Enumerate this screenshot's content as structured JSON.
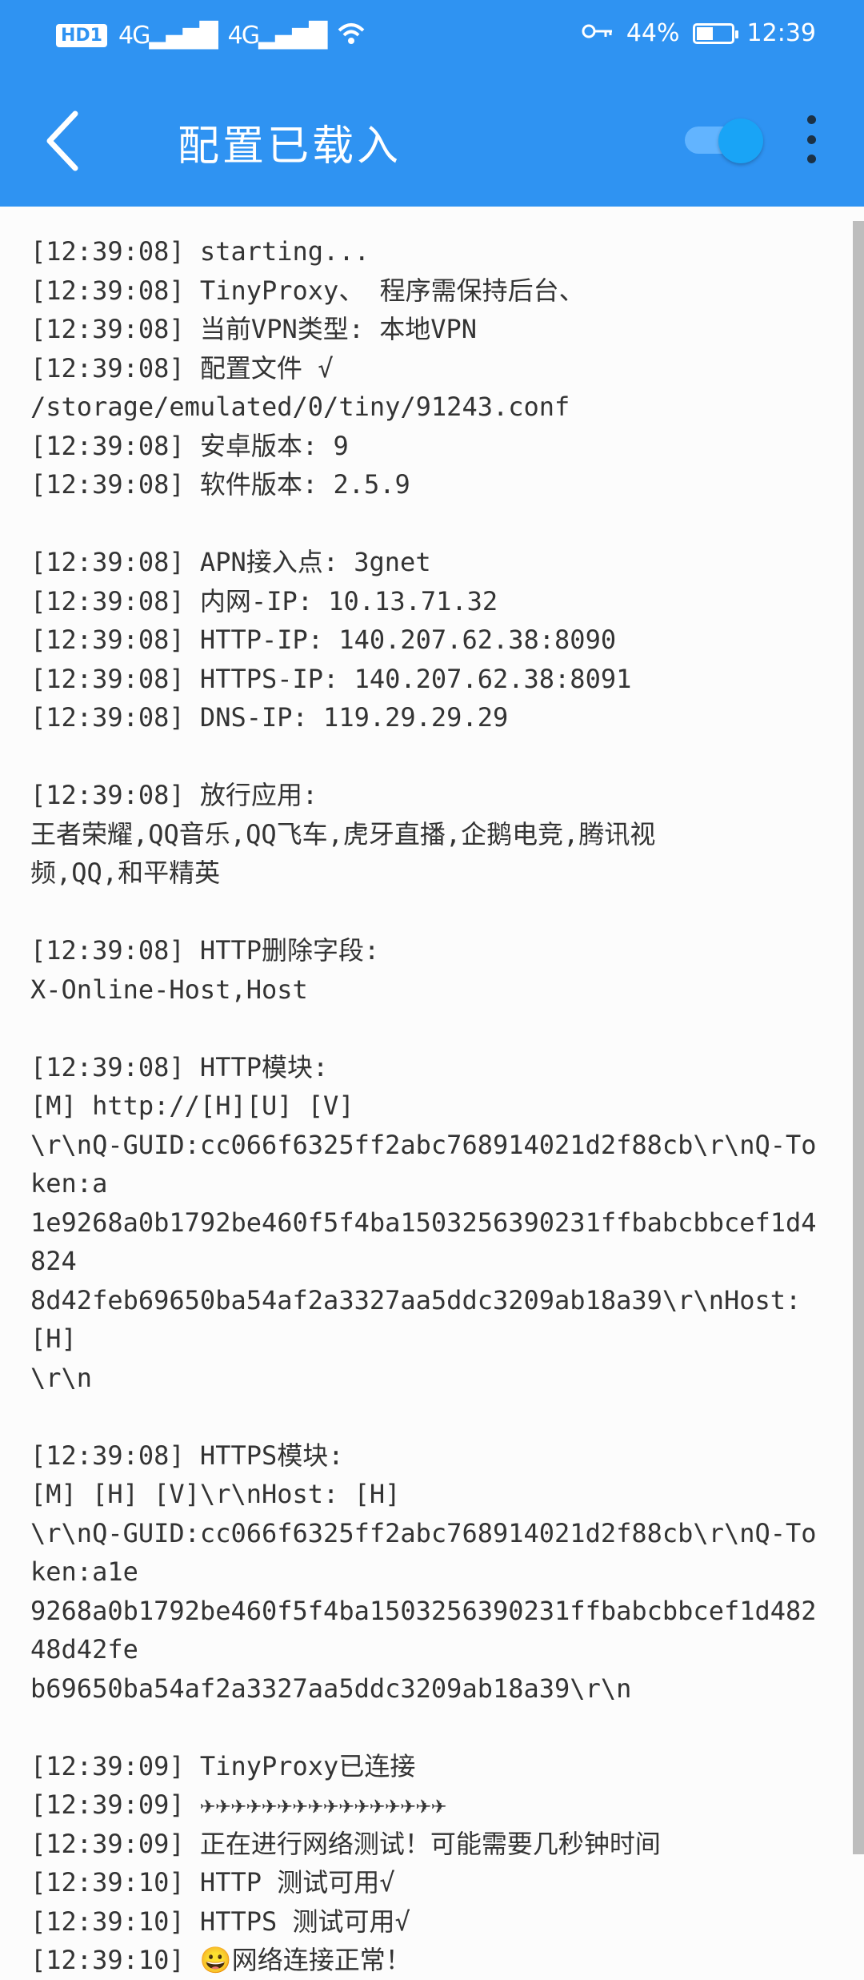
{
  "status_bar": {
    "left_items": [
      "HD1",
      "4G",
      "4G",
      "wifi-icon"
    ],
    "right_text": "44%",
    "time": "12:39",
    "battery_level": 0.44
  },
  "app_bar": {
    "title": "配置已载入",
    "toggle_on": true,
    "icons": [
      "back-arrow-icon",
      "toggle-switch",
      "more-vert-icon"
    ]
  },
  "log_lines": [
    "[12:39:08] starting...",
    "[12:39:08] TinyProxy、 程序需保持后台、",
    "[12:39:08] 当前VPN类型: 本地VPN",
    "[12:39:08] 配置文件 √",
    "/storage/emulated/0/tiny/91243.conf",
    "[12:39:08] 安卓版本: 9",
    "[12:39:08] 软件版本: 2.5.9",
    "",
    "[12:39:08] APN接入点: 3gnet",
    "[12:39:08] 内网-IP: 10.13.71.32",
    "[12:39:08] HTTP-IP: 140.207.62.38:8090",
    "[12:39:08] HTTPS-IP: 140.207.62.38:8091",
    "[12:39:08] DNS-IP: 119.29.29.29",
    "",
    "[12:39:08] 放行应用:",
    "王者荣耀,QQ音乐,QQ飞车,虎牙直播,企鹅电竞,腾讯视",
    "频,QQ,和平精英",
    "",
    "[12:39:08] HTTP删除字段:",
    "X-Online-Host,Host",
    "",
    "[12:39:08] HTTP模块:",
    "[M] http://[H][U] [V]",
    "\\r\\nQ-GUID:cc066f6325ff2abc768914021d2f88cb\\r\\nQ-Token:a",
    "1e9268a0b1792be460f5f4ba1503256390231ffbabcbbcef1d4824",
    "8d42feb69650ba54af2a3327aa5ddc3209ab18a39\\r\\nHost: [H]",
    "\\r\\n",
    "",
    "[12:39:08] HTTPS模块:",
    "[M] [H] [V]\\r\\nHost: [H]",
    "\\r\\nQ-GUID:cc066f6325ff2abc768914021d2f88cb\\r\\nQ-Token:a1e",
    "9268a0b1792be460f5f4ba1503256390231ffbabcbbcef1d48248d42fe",
    "b69650ba54af2a3327aa5ddc3209ab18a39\\r\\n",
    "",
    "[12:39:09] TinyProxy已连接",
    "[12:39:09] ✈✈✈✈✈✈✈✈✈✈✈✈✈✈✈✈",
    "[12:39:09] 正在进行网络测试！可能需要几秒钟时间",
    "[12:39:10] HTTP 测试可用√",
    "[12:39:10] HTTPS 测试可用√",
    "[12:39:10] 😀网络连接正常！"
  ]
}
